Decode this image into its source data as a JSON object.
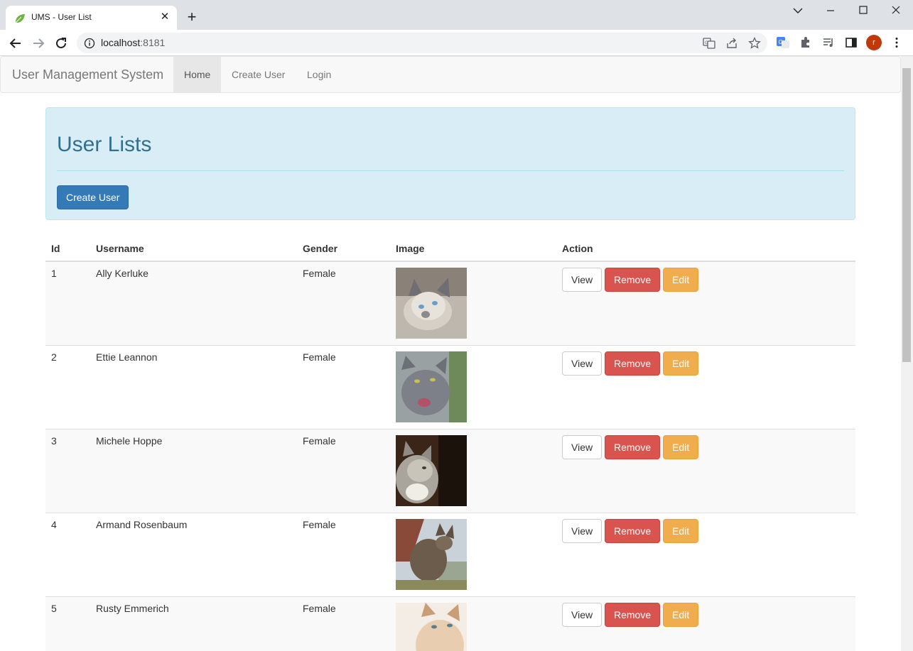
{
  "browser": {
    "tab_title": "UMS - User List",
    "url_host": "localhost",
    "url_port": ":8181",
    "profile_initial": "r"
  },
  "navbar": {
    "brand": "User Management System",
    "items": [
      {
        "label": "Home",
        "active": true
      },
      {
        "label": "Create User",
        "active": false
      },
      {
        "label": "Login",
        "active": false
      }
    ]
  },
  "jumbotron": {
    "title": "User Lists",
    "create_button": "Create User"
  },
  "table": {
    "headers": [
      "Id",
      "Username",
      "Gender",
      "Image",
      "Action"
    ],
    "rows": [
      {
        "id": "1",
        "username": "Ally Kerluke",
        "gender": "Female",
        "image": "cat-photo-1"
      },
      {
        "id": "2",
        "username": "Ettie Leannon",
        "gender": "Female",
        "image": "cat-photo-2"
      },
      {
        "id": "3",
        "username": "Michele Hoppe",
        "gender": "Female",
        "image": "cat-photo-3"
      },
      {
        "id": "4",
        "username": "Armand Rosenbaum",
        "gender": "Female",
        "image": "cat-photo-4"
      },
      {
        "id": "5",
        "username": "Rusty Emmerich",
        "gender": "Female",
        "image": "cat-photo-5"
      }
    ],
    "actions": {
      "view": "View",
      "remove": "Remove",
      "edit": "Edit"
    }
  },
  "colors": {
    "primary": "#337ab7",
    "danger": "#d9534f",
    "warning": "#f0ad4e",
    "jumbotron_bg": "#d9edf7",
    "jumbotron_title": "#31708f"
  }
}
